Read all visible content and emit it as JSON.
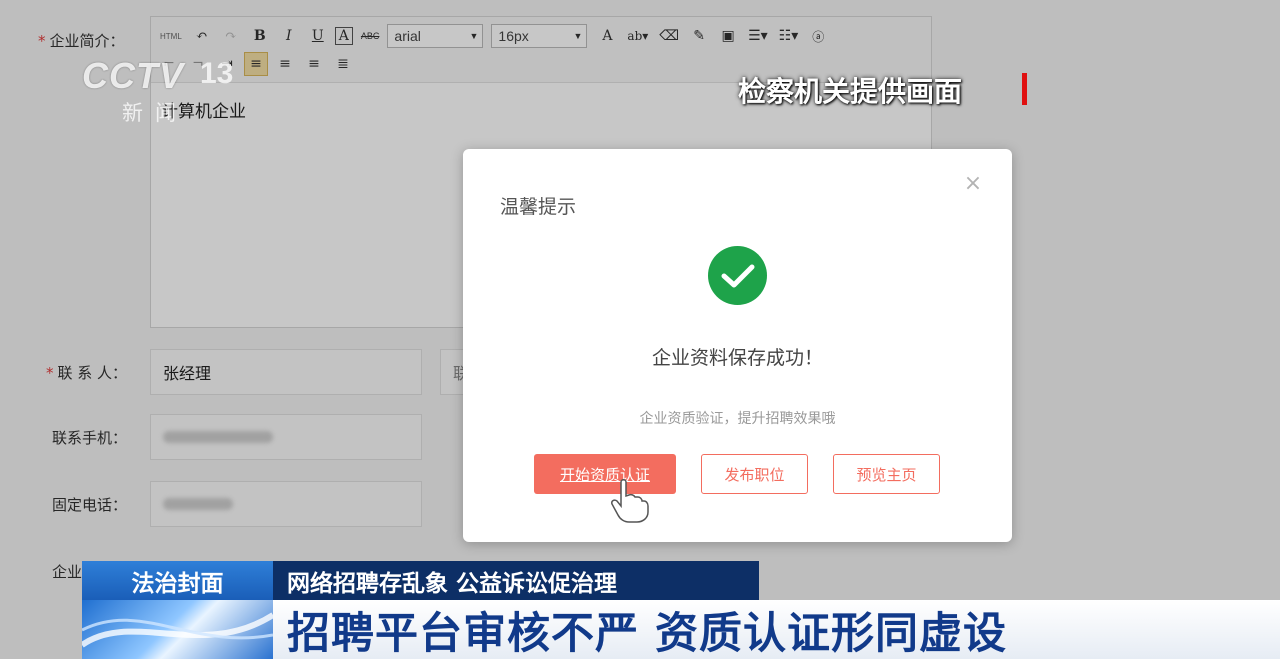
{
  "form": {
    "intro_label": "企业简介：",
    "contact_label": "联 系 人：",
    "contact_value": "张经理",
    "contact_side_char": "联",
    "mobile_label": "联系手机：",
    "phone_label": "固定电话：",
    "address_label": "企业"
  },
  "editor": {
    "font_family": "arial",
    "font_size": "16px",
    "body_text": "计算机企业",
    "bold_label": "B",
    "italic_label": "I",
    "underline_label": "U",
    "html_label": "HTML",
    "font_color_label": "A",
    "strike_label": "ABC"
  },
  "modal": {
    "title": "温馨提示",
    "close_glyph": "×",
    "message": "企业资料保存成功！",
    "sub_message": "企业资质验证，提升招聘效果哦",
    "btn_verify": "开始资质认证",
    "btn_post": "发布职位",
    "btn_preview": "预览主页"
  },
  "broadcast": {
    "logo_brand": "CCTV",
    "logo_channel": "13",
    "logo_news": "新闻",
    "source_caption": "检察机关提供画面",
    "program_name": "法治封面",
    "topic": "网络招聘存乱象 公益诉讼促治理",
    "headline": "招聘平台审核不严 资质认证形同虚设"
  },
  "colors": {
    "accent": "#f36d5f",
    "success": "#1ea34a",
    "headline_text": "#113a8a",
    "tag_blue": "#1a5eb8",
    "topic_navy": "#0d2f66"
  }
}
